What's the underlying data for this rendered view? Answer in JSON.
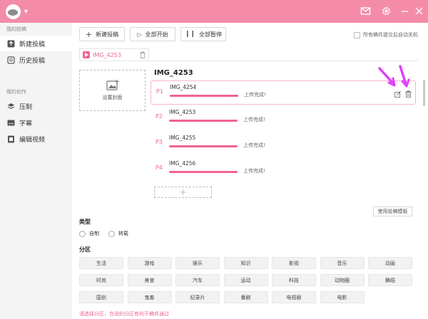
{
  "titlebar": {
    "logo_icon": "app-logo",
    "menu_icon": "chevron-down-icon",
    "mail_icon": "mail-icon",
    "settings_icon": "gear-icon",
    "minimize_icon": "minimize-icon",
    "close_icon": "close-icon",
    "background_color": "#f48ca9"
  },
  "sidebar": {
    "section1_label": "我的投稿",
    "items1": [
      {
        "label": "新建投稿",
        "icon": "upload-icon",
        "active": true
      },
      {
        "label": "历史投稿",
        "icon": "history-icon",
        "active": false
      }
    ],
    "section2_label": "我的创作",
    "items2": [
      {
        "label": "压制",
        "icon": "layers-icon"
      },
      {
        "label": "字幕",
        "icon": "subtitle-icon"
      },
      {
        "label": "编辑视频",
        "icon": "film-icon"
      }
    ]
  },
  "toolbar": {
    "new_label": "新建投稿",
    "start_all_label": "全部开始",
    "pause_all_label": "全部暂停",
    "auto_shutdown_label": "所有稿件提交后自动关机"
  },
  "tab": {
    "label": "IMG_4253",
    "icon": "video-icon",
    "close_icon": "trash-icon"
  },
  "cover": {
    "label": "设置封面",
    "icon": "image-add-icon"
  },
  "group_title": "IMG_4253",
  "files": [
    {
      "p": "P1",
      "name": "IMG_4254",
      "status": "上传完成!",
      "progress": 1.0
    },
    {
      "p": "P2",
      "name": "IMG_4253",
      "status": "上传完成!",
      "progress": 1.0
    },
    {
      "p": "P3",
      "name": "IMG_4255",
      "status": "上传完成!",
      "progress": 1.0
    },
    {
      "p": "P4",
      "name": "IMG_4256",
      "status": "上传完成!",
      "progress": 1.0
    }
  ],
  "row_actions": {
    "edit_icon": "edit-icon",
    "delete_icon": "trash-icon"
  },
  "add_file_label": "+",
  "template_button_label": "使用投稿模板",
  "type_section": {
    "title": "类型",
    "options": [
      "自制",
      "转载"
    ]
  },
  "category_section": {
    "title": "分区",
    "items": [
      "生活",
      "游戏",
      "娱乐",
      "知识",
      "影视",
      "音乐",
      "动画",
      "时尚",
      "美食",
      "汽车",
      "运动",
      "科技",
      "动物圈",
      "舞蹈",
      "国创",
      "鬼畜",
      "纪录片",
      "番剧",
      "电视剧",
      "电影"
    ]
  },
  "hint_text": "请选择分区，合适的分区有利于稿件通过",
  "colors": {
    "accent": "#f06292",
    "annotation_arrow": "#e040fb"
  }
}
